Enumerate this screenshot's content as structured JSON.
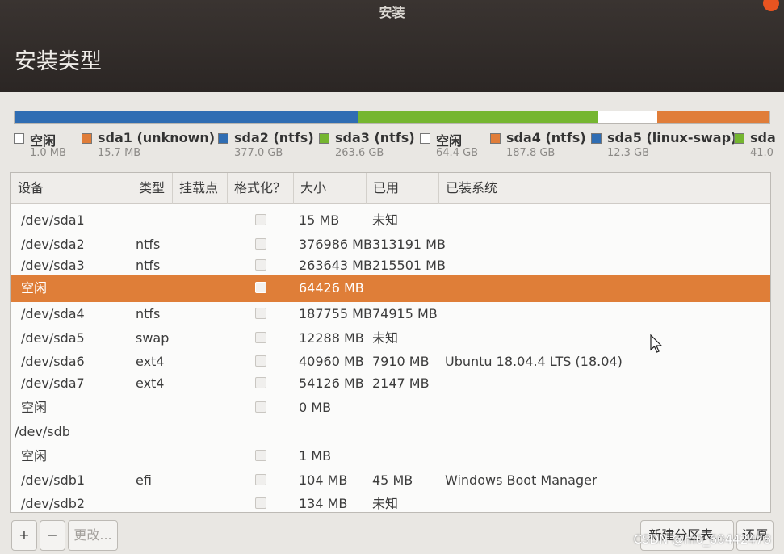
{
  "window": {
    "title": "安装"
  },
  "page": {
    "title": "安装类型"
  },
  "partition_bar": [
    {
      "color": "#ffffff",
      "width_pct": 0.1
    },
    {
      "color": "#2f6db3",
      "width_pct": 45.5
    },
    {
      "color": "#75b630",
      "width_pct": 31.7
    },
    {
      "color": "#ffffff",
      "width_pct": 7.8
    },
    {
      "color": "#e07d39",
      "width_pct": 14.9
    }
  ],
  "legend": [
    {
      "name": "空闲",
      "size": "1.0 MB",
      "color": "#ffffff"
    },
    {
      "name": "sda1 (unknown)",
      "size": "15.7 MB",
      "color": "#e07d39"
    },
    {
      "name": "sda2 (ntfs)",
      "size": "377.0 GB",
      "color": "#2f6db3"
    },
    {
      "name": "sda3 (ntfs)",
      "size": "263.6 GB",
      "color": "#75b630"
    },
    {
      "name": "空闲",
      "size": "64.4 GB",
      "color": "#ffffff"
    },
    {
      "name": "sda4 (ntfs)",
      "size": "187.8 GB",
      "color": "#e07d39"
    },
    {
      "name": "sda5 (linux-swap)",
      "size": "12.3 GB",
      "color": "#2f6db3"
    },
    {
      "name": "sda",
      "size": "41.0",
      "color": "#75b630"
    }
  ],
  "table": {
    "headers": {
      "device": "设备",
      "type": "类型",
      "mount": "挂载点",
      "format": "格式化？",
      "size": "大小",
      "used": "已用",
      "system": "已装系统"
    },
    "rows": [
      {
        "device": "/dev/sda1",
        "type": "",
        "size": "15 MB",
        "used": "未知",
        "system": ""
      },
      {
        "device": "/dev/sda2",
        "type": "ntfs",
        "size": "376986 MB",
        "used": "313191 MB",
        "system": ""
      },
      {
        "device": "/dev/sda3",
        "type": "ntfs",
        "size": "263643 MB",
        "used": "215501 MB",
        "system": ""
      },
      {
        "device": "空闲",
        "type": "",
        "size": "64426 MB",
        "used": "",
        "system": ""
      },
      {
        "device": "/dev/sda4",
        "type": "ntfs",
        "size": "187755 MB",
        "used": "74915 MB",
        "system": ""
      },
      {
        "device": "/dev/sda5",
        "type": "swap",
        "size": "12288 MB",
        "used": "未知",
        "system": ""
      },
      {
        "device": "/dev/sda6",
        "type": "ext4",
        "size": "40960 MB",
        "used": "7910 MB",
        "system": "Ubuntu 18.04.4 LTS (18.04)"
      },
      {
        "device": "/dev/sda7",
        "type": "ext4",
        "size": "54126 MB",
        "used": "2147 MB",
        "system": ""
      },
      {
        "device": "空闲",
        "type": "",
        "size": "0 MB",
        "used": "",
        "system": ""
      },
      {
        "device": "/dev/sdb",
        "type": "",
        "size": "",
        "used": "",
        "system": ""
      },
      {
        "device": "空闲",
        "type": "",
        "size": "1 MB",
        "used": "",
        "system": ""
      },
      {
        "device": "/dev/sdb1",
        "type": "efi",
        "size": "104 MB",
        "used": "45 MB",
        "system": "Windows Boot Manager"
      },
      {
        "device": "/dev/sdb2",
        "type": "",
        "size": "134 MB",
        "used": "未知",
        "system": ""
      }
    ]
  },
  "buttons": {
    "add": "+",
    "remove": "−",
    "change": "更改...",
    "new_table": "新建分区表...",
    "revert": "还原"
  },
  "watermark": "CSDN @m0_60442478"
}
